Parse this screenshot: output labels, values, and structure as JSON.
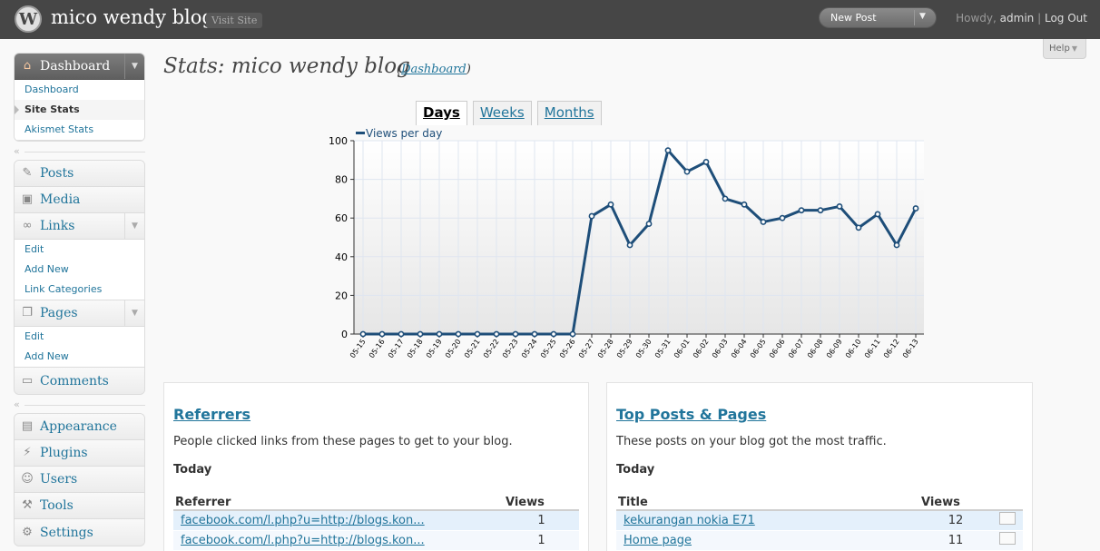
{
  "header": {
    "logo_letter": "W",
    "site_title": "mico wendy blog",
    "visit_site": "Visit Site",
    "new_post": "New Post",
    "new_post_arrow": "▼",
    "howdy_prefix": "Howdy,",
    "username": "admin",
    "separator": "|",
    "logout": "Log Out"
  },
  "help": {
    "label": "Help",
    "arrow": "▼"
  },
  "sidebar": {
    "dashboard": {
      "label": "Dashboard",
      "items": [
        "Dashboard",
        "Site Stats",
        "Akismet Stats"
      ]
    },
    "posts": "Posts",
    "media": "Media",
    "links": {
      "label": "Links",
      "items": [
        "Edit",
        "Add New",
        "Link Categories"
      ]
    },
    "pages": {
      "label": "Pages",
      "items": [
        "Edit",
        "Add New"
      ]
    },
    "comments": "Comments",
    "appearance": "Appearance",
    "plugins": "Plugins",
    "users": "Users",
    "tools": "Tools",
    "settings": "Settings",
    "collapse_glyph": "«",
    "toggle_glyph": "▼"
  },
  "page": {
    "title": "Stats: mico wendy blog",
    "dashboard_link": "Dashboard",
    "paren_open": "(",
    "paren_close": ")"
  },
  "tabs": [
    "Days",
    "Weeks",
    "Months"
  ],
  "active_tab": "Days",
  "chart_data": {
    "type": "line",
    "legend": "Views per day",
    "ylim": [
      0,
      100
    ],
    "yticks": [
      0,
      20,
      40,
      60,
      80,
      100
    ],
    "grid": true,
    "color": "#1e4e79",
    "x": [
      "05-15",
      "05-16",
      "05-17",
      "05-18",
      "05-19",
      "05-20",
      "05-21",
      "05-22",
      "05-23",
      "05-24",
      "05-25",
      "05-26",
      "05-27",
      "05-28",
      "05-29",
      "05-30",
      "05-31",
      "06-01",
      "06-02",
      "06-03",
      "06-04",
      "06-05",
      "06-06",
      "06-07",
      "06-08",
      "06-09",
      "06-10",
      "06-11",
      "06-12",
      "06-13"
    ],
    "series": [
      {
        "name": "Views per day",
        "values": [
          0,
          0,
          0,
          0,
          0,
          0,
          0,
          0,
          0,
          0,
          0,
          0,
          61,
          67,
          46,
          57,
          95,
          84,
          89,
          70,
          67,
          58,
          60,
          64,
          64,
          66,
          55,
          62,
          46,
          65
        ]
      }
    ]
  },
  "referrers": {
    "title": "Referrers",
    "desc": "People clicked links from these pages to get to your blog.",
    "period": "Today",
    "col_referrer": "Referrer",
    "col_views": "Views",
    "rows": [
      {
        "label": "facebook.com/l.php?u=http://blogs.kon...",
        "views": "1"
      },
      {
        "label": "facebook.com/l.php?u=http://blogs.kon...",
        "views": "1"
      }
    ]
  },
  "top_posts": {
    "title": "Top Posts & Pages",
    "desc": "These posts on your blog got the most traffic.",
    "period": "Today",
    "col_title": "Title",
    "col_views": "Views",
    "rows": [
      {
        "label": "kekurangan nokia E71",
        "views": "12"
      },
      {
        "label": "Home page",
        "views": "11"
      }
    ]
  }
}
